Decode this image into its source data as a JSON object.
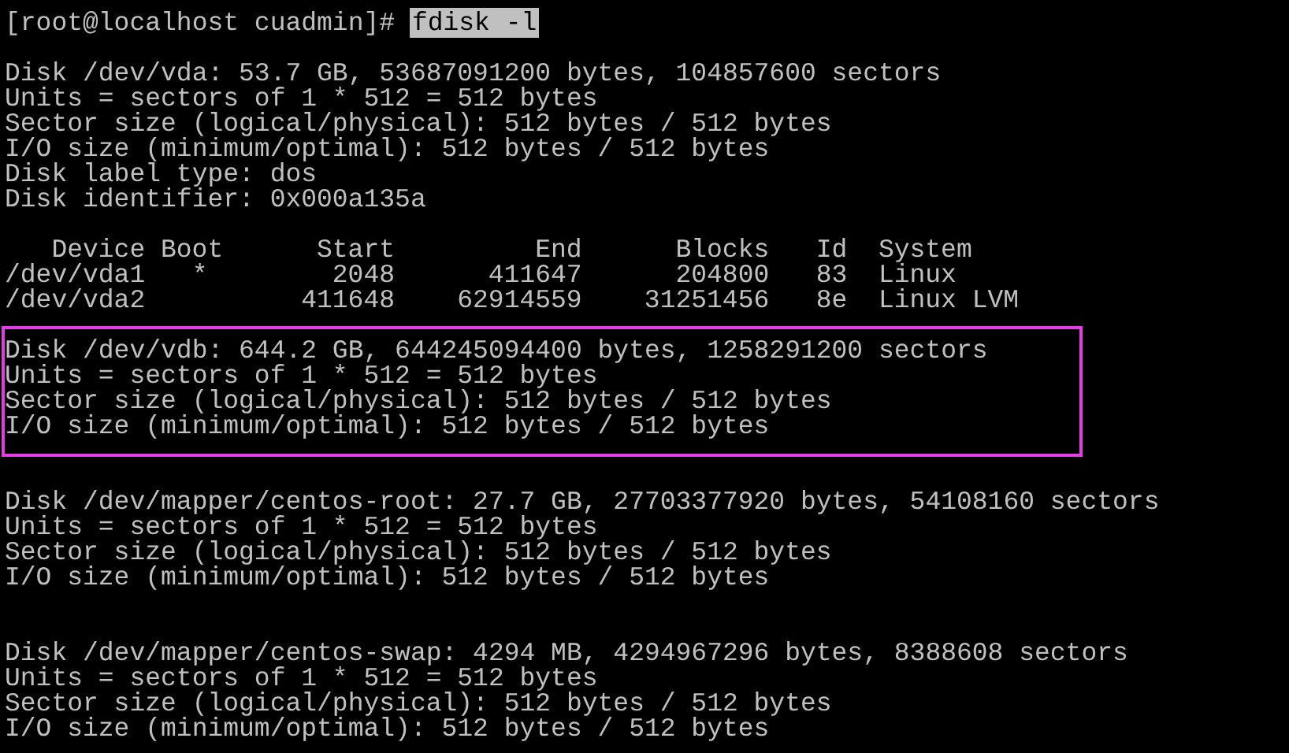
{
  "terminal": {
    "prompt": "[root@localhost cuadmin]#",
    "command": "fdisk -l",
    "command_selected": true,
    "disks": [
      {
        "highlighted": false,
        "lines": [
          "Disk /dev/vda: 53.7 GB, 53687091200 bytes, 104857600 sectors",
          "Units = sectors of 1 * 512 = 512 bytes",
          "Sector size (logical/physical): 512 bytes / 512 bytes",
          "I/O size (minimum/optimal): 512 bytes / 512 bytes",
          "Disk label type: dos",
          "Disk identifier: 0x000a135a"
        ],
        "partitions": {
          "columns": [
            "Device",
            "Boot",
            "Start",
            "End",
            "Blocks",
            "Id",
            "System"
          ],
          "rows": [
            [
              "/dev/vda1",
              "*",
              "2048",
              "411647",
              "204800",
              "83",
              "Linux"
            ],
            [
              "/dev/vda2",
              "",
              "411648",
              "62914559",
              "31251456",
              "8e",
              "Linux LVM"
            ]
          ]
        }
      },
      {
        "highlighted": true,
        "lines": [
          "Disk /dev/vdb: 644.2 GB, 644245094400 bytes, 1258291200 sectors",
          "Units = sectors of 1 * 512 = 512 bytes",
          "Sector size (logical/physical): 512 bytes / 512 bytes",
          "I/O size (minimum/optimal): 512 bytes / 512 bytes"
        ]
      },
      {
        "highlighted": false,
        "lines": [
          "Disk /dev/mapper/centos-root: 27.7 GB, 27703377920 bytes, 54108160 sectors",
          "Units = sectors of 1 * 512 = 512 bytes",
          "Sector size (logical/physical): 512 bytes / 512 bytes",
          "I/O size (minimum/optimal): 512 bytes / 512 bytes"
        ]
      },
      {
        "highlighted": false,
        "lines": [
          "Disk /dev/mapper/centos-swap: 4294 MB, 4294967296 bytes, 8388608 sectors",
          "Units = sectors of 1 * 512 = 512 bytes",
          "Sector size (logical/physical): 512 bytes / 512 bytes",
          "I/O size (minimum/optimal): 512 bytes / 512 bytes"
        ]
      }
    ]
  }
}
